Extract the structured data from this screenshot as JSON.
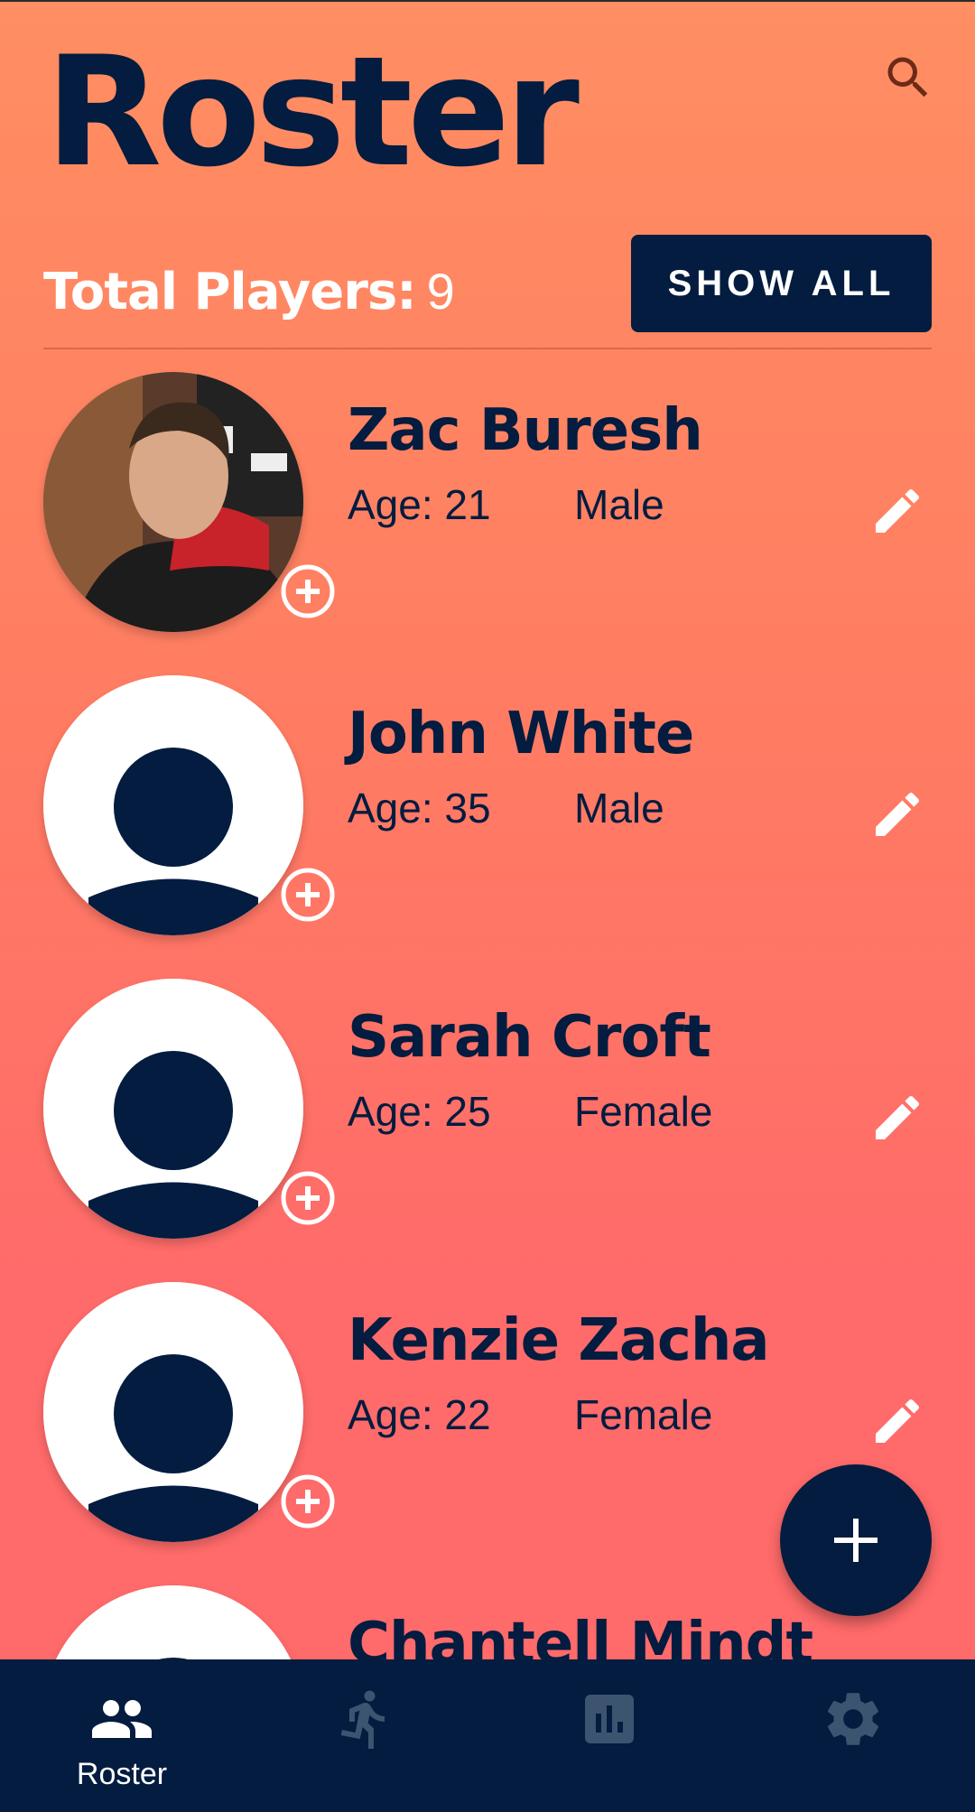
{
  "header": {
    "title": "Roster",
    "search_icon": "search-icon"
  },
  "summary": {
    "total_label": "Total Players:",
    "total_value": "9",
    "show_all_label": "SHOW ALL"
  },
  "players": [
    {
      "name": "Zac Buresh",
      "age": "Age: 21",
      "gender": "Male",
      "photo": "user-photo"
    },
    {
      "name": "John White",
      "age": "Age: 35",
      "gender": "Male",
      "photo": "default-avatar-icon"
    },
    {
      "name": "Sarah Croft",
      "age": "Age: 25",
      "gender": "Female",
      "photo": "default-avatar-icon"
    },
    {
      "name": "Kenzie Zacha",
      "age": "Age: 22",
      "gender": "Female",
      "photo": "default-avatar-icon"
    },
    {
      "name": "Chantell Mindt",
      "age": "",
      "gender": "",
      "photo": "default-avatar-icon"
    }
  ],
  "fab": {
    "icon": "plus-icon"
  },
  "bottom_nav": [
    {
      "label": "Roster",
      "icon": "people-icon",
      "active": true
    },
    {
      "label": "",
      "icon": "run-icon",
      "active": false
    },
    {
      "label": "",
      "icon": "bar-chart-icon",
      "active": false
    },
    {
      "label": "",
      "icon": "gear-icon",
      "active": false
    }
  ],
  "colors": {
    "navy": "#031c3f",
    "gradient_top": "#ff8e62",
    "gradient_bottom": "#ff6a6a",
    "inactive_nav": "#3c5470"
  }
}
